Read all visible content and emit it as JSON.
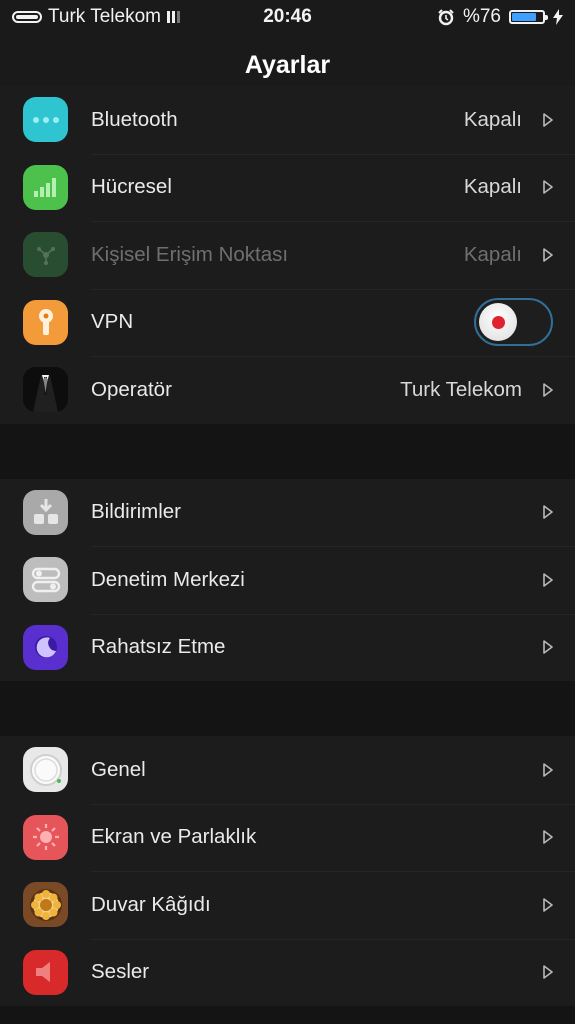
{
  "status_bar": {
    "carrier": "Turk Telekom",
    "time": "20:46",
    "battery_text": "%76",
    "battery_level": 0.76
  },
  "nav": {
    "title": "Ayarlar"
  },
  "groups": [
    {
      "rows": [
        {
          "label": "Bluetooth",
          "value": "Kapalı",
          "icon": "bluetooth-icon",
          "icon_color": "#2ec4d0"
        },
        {
          "label": "Hücresel",
          "value": "Kapalı",
          "icon": "cellular-icon",
          "icon_color": "#4cc24c"
        },
        {
          "label": "Kişisel Erişim Noktası",
          "value": "Kapalı",
          "icon": "hotspot-icon",
          "icon_color": "#3a8a4a",
          "disabled": true
        },
        {
          "label": "VPN",
          "toggle": false,
          "icon": "vpn-icon",
          "icon_color": "#f39a3a"
        },
        {
          "label": "Operatör",
          "value": "Turk Telekom",
          "icon": "operator-icon",
          "icon_color": "#111111"
        }
      ]
    },
    {
      "rows": [
        {
          "label": "Bildirimler",
          "icon": "notifications-icon",
          "icon_color": "#a9a9a9"
        },
        {
          "label": "Denetim Merkezi",
          "icon": "control-center-icon",
          "icon_color": "#bdbdbd"
        },
        {
          "label": "Rahatsız Etme",
          "icon": "do-not-disturb-icon",
          "icon_color": "#5a2fd0"
        }
      ]
    },
    {
      "rows": [
        {
          "label": "Genel",
          "icon": "general-icon",
          "icon_color": "#e8e8e8"
        },
        {
          "label": "Ekran ve Parlaklık",
          "icon": "display-brightness-icon",
          "icon_color": "#e6555a"
        },
        {
          "label": "Duvar Kâğıdı",
          "icon": "wallpaper-icon",
          "icon_color": "#7a4a26"
        },
        {
          "label": "Sesler",
          "icon": "sounds-icon",
          "icon_color": "#d82a2a"
        }
      ]
    }
  ]
}
